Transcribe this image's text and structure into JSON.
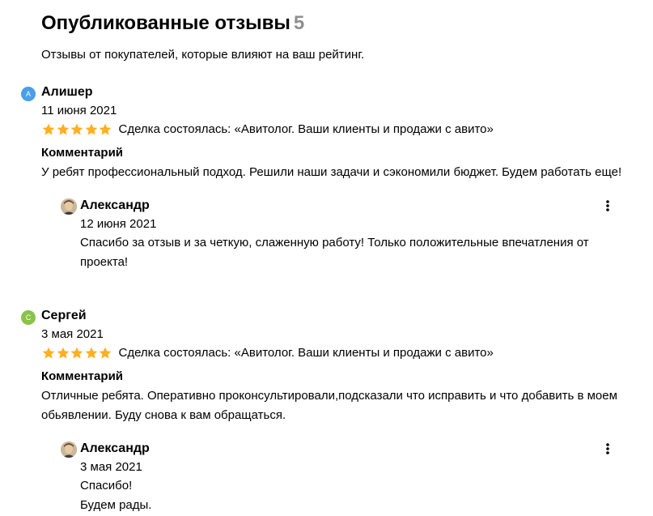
{
  "page": {
    "title": "Опубликованные отзывы",
    "count": "5",
    "subtitle": "Отзывы от покупателей, которые влияют на ваш рейтинг."
  },
  "colors": {
    "star": "#ffb021",
    "avatar_a": "#4a9eea",
    "avatar_c": "#8bc34a",
    "count": "#8f8f8f"
  },
  "reviews": [
    {
      "initial": "А",
      "author": "Алишер",
      "date": "11 июня 2021",
      "rating": 5,
      "deal": "Сделка состоялась: «Авитолог. Ваши клиенты и продажи с авито»",
      "comment_label": "Комментарий",
      "comment": "У ребят профессиональный подход. Решили наши задачи и сэкономили бюджет. Будем работать еще!",
      "reply": {
        "author": "Александр",
        "date": "12 июня 2021",
        "lines": [
          "Спасибо за отзыв и за четкую, слаженную работу! Только положительные впечатления от проекта!"
        ]
      }
    },
    {
      "initial": "С",
      "author": "Сергей",
      "date": "3 мая 2021",
      "rating": 5,
      "deal": "Сделка состоялась: «Авитолог. Ваши клиенты и продажи с авито»",
      "comment_label": "Комментарий",
      "comment": "Отличные ребята. Оперативно проконсультировали,подсказали что исправить и что добавить в моем обьявлении. Буду снова к вам обращаться.",
      "reply": {
        "author": "Александр",
        "date": "3 мая 2021",
        "lines": [
          "Спасибо!",
          "Будем рады."
        ]
      }
    }
  ]
}
